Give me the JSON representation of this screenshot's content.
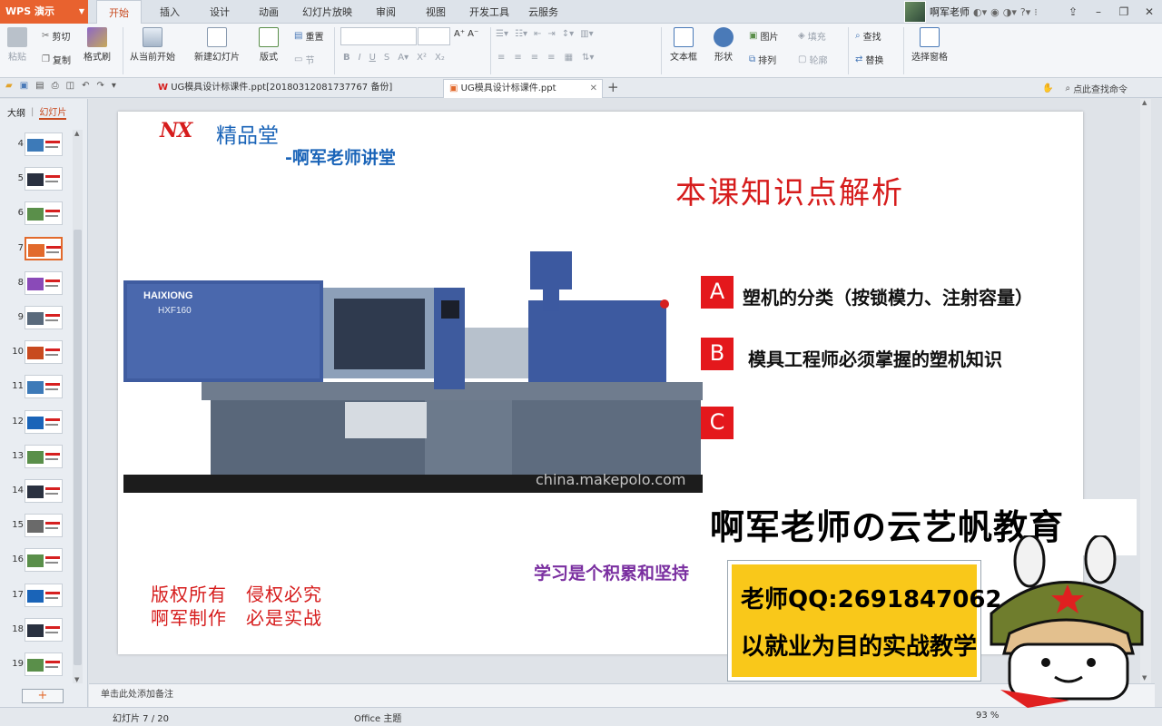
{
  "app": {
    "name": "WPS 演示"
  },
  "menu_tabs": [
    "开始",
    "插入",
    "设计",
    "动画",
    "幻灯片放映",
    "审阅",
    "视图",
    "开发工具",
    "云服务"
  ],
  "active_menu": "开始",
  "user": {
    "name": "啊军老师"
  },
  "ribbon": {
    "paste": "粘贴",
    "cut": "剪切",
    "copy": "复制",
    "format_painter": "格式刷",
    "from_current": "从当前开始",
    "new_slide": "新建幻灯片",
    "layout": "版式",
    "reset": "重置",
    "section": "节",
    "text_box": "文本框",
    "shape": "形状",
    "picture": "图片",
    "fill": "填充",
    "arrange": "排列",
    "outline": "轮廓",
    "find": "查找",
    "replace": "替换",
    "select_pane": "选择窗格"
  },
  "doc_tabs": [
    {
      "label": "UG模具设计标课件.ppt[20180312081737767 备份]"
    },
    {
      "label": "UG模具设计标课件.ppt"
    }
  ],
  "search_command": "点此查找命令",
  "sidebar": {
    "tab_outline": "大纲",
    "tab_slides": "幻灯片",
    "slide_numbers": [
      "4",
      "5",
      "6",
      "7",
      "8",
      "9",
      "10",
      "11",
      "12",
      "13",
      "14",
      "15",
      "16",
      "17",
      "18",
      "19"
    ],
    "selected": "7"
  },
  "slide": {
    "logo": "NX",
    "logo_text": "精品堂",
    "subtitle": "-啊军老师讲堂",
    "title": "本课知识点解析",
    "machine_brand": "HAIXIONG",
    "machine_model": "HXF160",
    "watermark": "china.makepolo.com",
    "points": [
      {
        "letter": "A",
        "text": "塑机的分类（按锁模力、注射容量）"
      },
      {
        "letter": "B",
        "text": "模具工程师必须掌握的塑机知识"
      },
      {
        "letter": "C",
        "text": ""
      }
    ],
    "copyright_line1": "版权所有　侵权必究",
    "copyright_line2": "啊军制作　必是实战",
    "slogan": "学习是个积累和坚持"
  },
  "promo": {
    "title": "啊军老师の云艺帆教育",
    "qq": "老师QQ:2691847062",
    "tagline": "以就业为目的实战教学"
  },
  "notes_placeholder": "单击此处添加备注",
  "status": {
    "slide_counter": "幻灯片 7 / 20",
    "theme": "Office 主题",
    "zoom": "93 %"
  },
  "colors": {
    "accent": "#e26a2c",
    "slide_red": "#d61c1c",
    "slide_blue": "#1a64b8"
  }
}
